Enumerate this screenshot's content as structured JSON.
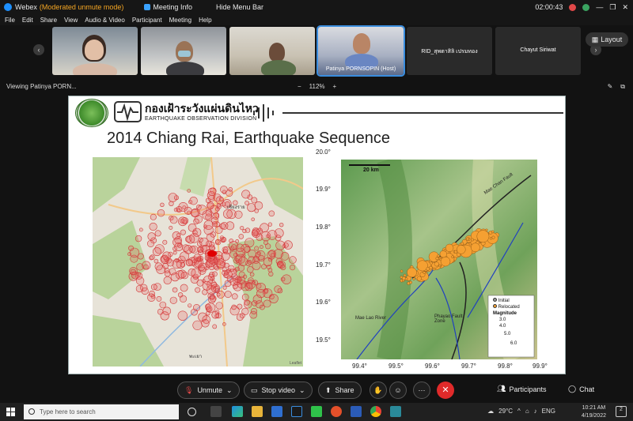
{
  "titlebar": {
    "app": "Webex",
    "mode": "(Moderated unmute mode)",
    "meeting_info": "Meeting Info",
    "hide_menu": "Hide Menu Bar",
    "time": "02:00:43"
  },
  "menu": [
    "File",
    "Edit",
    "Share",
    "View",
    "Audio & Video",
    "Participant",
    "Meeting",
    "Help"
  ],
  "participants": [
    {
      "name": ""
    },
    {
      "name": ""
    },
    {
      "name": ""
    },
    {
      "name": "Patinya PORNSOPIN (Host)"
    },
    {
      "name": "RID_สุพตาสิลิ เปรมทอง"
    },
    {
      "name": "Chayut Siriwat"
    }
  ],
  "layout_label": "Layout",
  "viewing": {
    "label": "Viewing Patinya PORN...",
    "zoom": "112%",
    "minus": "−",
    "plus": "+"
  },
  "slide": {
    "org_thai": "กองเฝ้าระวังแผ่นดินไหว",
    "org_en": "EARTHQUAKE OBSERVATION DIVISION",
    "title": "2014 Chiang Rai, Earthquake Sequence",
    "left_map": {
      "town1": "เชียงราย",
      "town2": "พะเยา",
      "attribution": "Leaflet"
    },
    "right_map": {
      "scale": "20 km",
      "lat_ticks": [
        "20.0°",
        "19.9°",
        "19.8°",
        "19.7°",
        "19.6°",
        "19.5°"
      ],
      "lon_ticks": [
        "99.4°",
        "99.5°",
        "99.6°",
        "99.7°",
        "99.8°",
        "99.9°"
      ],
      "labels": [
        "Mae Chan Fault",
        "Mae Lao River",
        "Phayao Fault Zone"
      ],
      "legend": {
        "initial": "Initial",
        "relocated": "Relocated",
        "magnitude": "Magnitude",
        "m3": "3.0",
        "m4": "4.0",
        "m5": "5.0",
        "m6": "6.0"
      }
    }
  },
  "dock": {
    "unmute": "Unmute",
    "stop_video": "Stop video",
    "share": "Share",
    "participants": "Participants",
    "chat": "Chat"
  },
  "taskbar": {
    "search": "Type here to search",
    "temp": "29°C",
    "lang": "ENG",
    "time": "10:21 AM",
    "date": "4/19/2022",
    "notifications": "2"
  },
  "colors": {
    "accent": "#3a8dde",
    "end_call": "#e02a2a",
    "quake_dot": "#f5a032",
    "mode_text": "#f5a623"
  }
}
